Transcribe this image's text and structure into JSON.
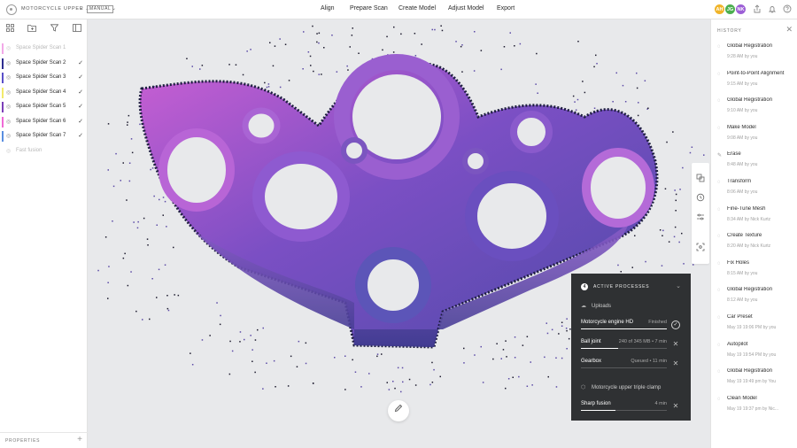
{
  "topbar": {
    "project_title": "MOTORCYCLE UPPER ...",
    "project_caret": "⌄",
    "mode": "MANUAL",
    "mode_caret": "⌄",
    "menu": [
      "Align",
      "Prepare Scan",
      "Create Model",
      "Adjust Model",
      "Export"
    ],
    "avatars": [
      {
        "initials": "AH",
        "color": "#f0b429"
      },
      {
        "initials": "JG",
        "color": "#4caf50"
      },
      {
        "initials": "NK",
        "color": "#9c5fd6"
      }
    ]
  },
  "left_panel": {
    "layers": [
      {
        "name": "Space Spider Scan 1",
        "color": "#f2a8e8",
        "checked": false,
        "dim": true
      },
      {
        "name": "Space Spider Scan 2",
        "color": "#2e2d8f",
        "checked": true,
        "dim": false
      },
      {
        "name": "Space Spider Scan 3",
        "color": "#5a4fc8",
        "checked": true,
        "dim": false
      },
      {
        "name": "Space Spider Scan 4",
        "color": "#f2ea6a",
        "checked": true,
        "dim": false
      },
      {
        "name": "Space Spider Scan 5",
        "color": "#7b3fb8",
        "checked": true,
        "dim": false
      },
      {
        "name": "Space Spider Scan 6",
        "color": "#f06ad6",
        "checked": true,
        "dim": false
      },
      {
        "name": "Space Spider Scan 7",
        "color": "#5a8ee0",
        "checked": true,
        "dim": false
      },
      {
        "name": "Fast fusion",
        "color": "transparent",
        "checked": false,
        "dim": true
      }
    ],
    "properties_label": "PROPERTIES",
    "properties_add": "+"
  },
  "active_processes": {
    "count": "4",
    "title": "ACTIVE PROCESSES",
    "sections": [
      {
        "label": "Uploads",
        "rows": [
          {
            "name": "Motorcycle engine HD",
            "status": "Finished",
            "progress": 1.0,
            "action": "done"
          },
          {
            "name": "Ball joint",
            "status": "240 of 345 MB • 7 min",
            "progress": 0.43,
            "action": "cancel"
          },
          {
            "name": "Gearbox",
            "status": "Queued • 11 min",
            "progress": 0.0,
            "action": "cancel"
          }
        ]
      },
      {
        "label": "Motorcycle upper triple clamp",
        "rows": [
          {
            "name": "Sharp fusion",
            "status": "4 min",
            "progress": 0.4,
            "action": "cancel"
          }
        ]
      }
    ]
  },
  "history": {
    "title": "HISTORY",
    "items": [
      {
        "name": "Global Registration",
        "time": "9:28 AM by you",
        "icon": "◌"
      },
      {
        "name": "Point-to-Point Alignment",
        "time": "9:15 AM by you",
        "icon": "◌"
      },
      {
        "name": "Global Registration",
        "time": "9:10 AM by you",
        "icon": "◌"
      },
      {
        "name": "Make Model",
        "time": "9:08 AM by you",
        "icon": "◌"
      },
      {
        "name": "Erase",
        "time": "8:48 AM by you",
        "icon": "✎"
      },
      {
        "name": "Transform",
        "time": "8:06 AM by you",
        "icon": "◌"
      },
      {
        "name": "Fine-Tune Mesh",
        "time": "8:34 AM by Nick Kurtz",
        "icon": "◌"
      },
      {
        "name": "Create Texture",
        "time": "8:20 AM by Nick Kurtz",
        "icon": "◌"
      },
      {
        "name": "Fix Holes",
        "time": "8:15 AM by you",
        "icon": "◌"
      },
      {
        "name": "Global Registration",
        "time": "8:12 AM by you",
        "icon": "◌"
      },
      {
        "name": "Car Preset",
        "time": "May 19 19:06 PM by you",
        "icon": "◌"
      },
      {
        "name": "Autopilot",
        "time": "May 19 19:54 PM by you",
        "icon": "◌"
      },
      {
        "name": "Global Registration",
        "time": "May 19 19:49 pm by You",
        "icon": "◌"
      },
      {
        "name": "Clean Model",
        "time": "May 19 19:37 pm by Nic...",
        "icon": "◌"
      }
    ]
  }
}
